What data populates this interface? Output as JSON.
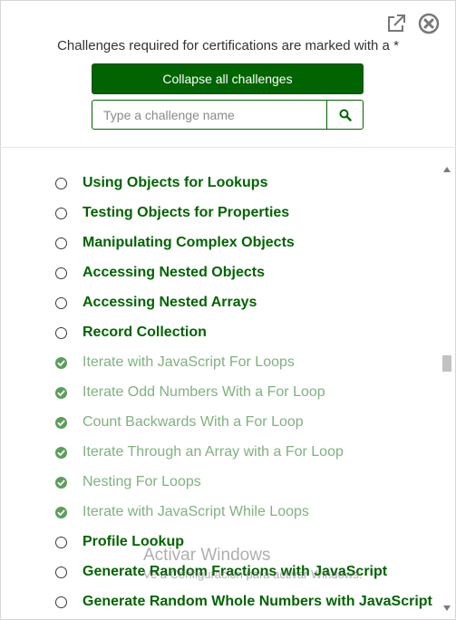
{
  "header": {
    "note": "Challenges required for certifications are marked with a *",
    "collapse_label": "Collapse all challenges",
    "search_placeholder": "Type a challenge name"
  },
  "challenges": [
    {
      "title": "Using Objects for Lookups",
      "completed": false
    },
    {
      "title": "Testing Objects for Properties",
      "completed": false
    },
    {
      "title": "Manipulating Complex Objects",
      "completed": false
    },
    {
      "title": "Accessing Nested Objects",
      "completed": false
    },
    {
      "title": "Accessing Nested Arrays",
      "completed": false
    },
    {
      "title": "Record Collection",
      "completed": false
    },
    {
      "title": "Iterate with JavaScript For Loops",
      "completed": true
    },
    {
      "title": "Iterate Odd Numbers With a For Loop",
      "completed": true
    },
    {
      "title": "Count Backwards With a For Loop",
      "completed": true
    },
    {
      "title": "Iterate Through an Array with a For Loop",
      "completed": true
    },
    {
      "title": "Nesting For Loops",
      "completed": true
    },
    {
      "title": "Iterate with JavaScript While Loops",
      "completed": true
    },
    {
      "title": "Profile Lookup",
      "completed": false
    },
    {
      "title": "Generate Random Fractions with JavaScript",
      "completed": false
    },
    {
      "title": "Generate Random Whole Numbers with JavaScript",
      "completed": false
    }
  ],
  "watermark": {
    "line1": "Activar Windows",
    "line2": "Ve a Configuración para activar Windows."
  },
  "colors": {
    "primary": "#006400",
    "completed_text": "#7fb27f",
    "check_fill": "#5c9e5c"
  }
}
